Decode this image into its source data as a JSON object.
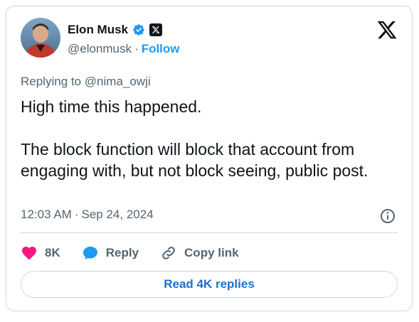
{
  "author": {
    "name": "Elon Musk",
    "handle": "@elonmusk",
    "separator": "·",
    "follow_label": "Follow",
    "avatar_icon": "avatar-photo",
    "verified_icon": "verified-badge-icon",
    "affiliation_icon": "x-affiliation-icon"
  },
  "brand": {
    "logo_icon": "x-logo-icon"
  },
  "reply": {
    "prefix": "Replying to",
    "mention": "@nima_owji"
  },
  "tweet": {
    "text": "High time this happened.\n\nThe block function will block that account from engaging with, but not block seeing, public post."
  },
  "meta": {
    "time": "12:03 AM",
    "separator": "·",
    "date": "Sep 24, 2024",
    "info_icon": "info-icon"
  },
  "actions": {
    "like": {
      "icon": "heart-icon",
      "count": "8K"
    },
    "reply": {
      "icon": "speech-bubble-icon",
      "label": "Reply"
    },
    "copy": {
      "icon": "link-icon",
      "label": "Copy link"
    }
  },
  "footer": {
    "read_replies_label": "Read 4K replies"
  },
  "colors": {
    "accent": "#1d9bf0",
    "like": "#f91880",
    "text_primary": "#0f1419",
    "text_secondary": "#536471",
    "border": "#cfd9de"
  }
}
